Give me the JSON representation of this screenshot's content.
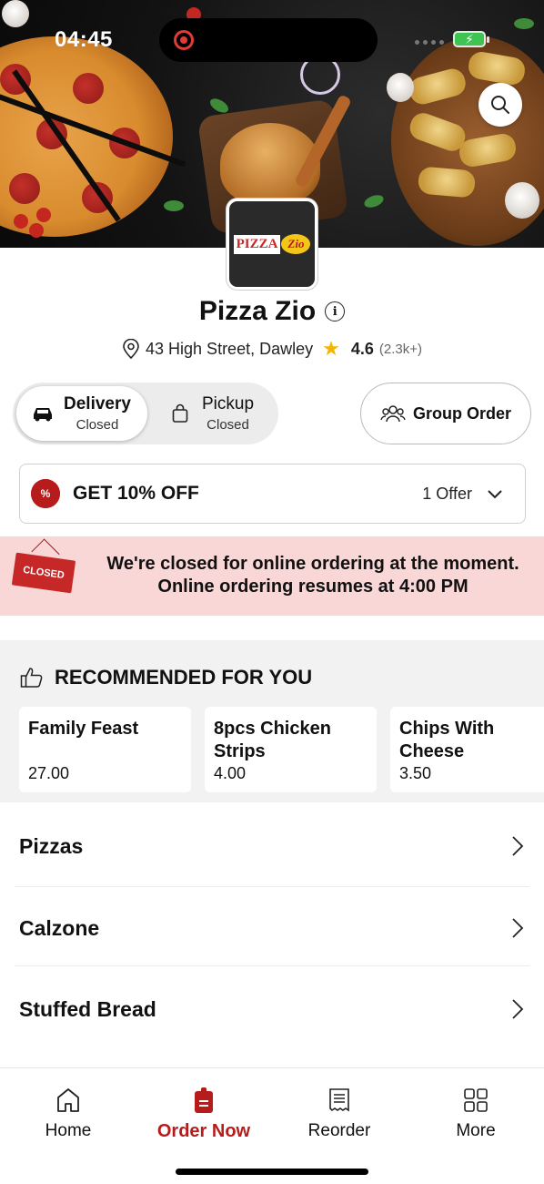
{
  "status_bar": {
    "time": "04:45"
  },
  "restaurant": {
    "name": "Pizza Zio",
    "address": "43 High Street, Dawley",
    "rating": "4.6",
    "rating_count": "(2.3k+)",
    "logo_text": "PIZZA",
    "logo_script": "Zio"
  },
  "order_mode": {
    "delivery": {
      "label": "Delivery",
      "status": "Closed",
      "selected": true
    },
    "pickup": {
      "label": "Pickup",
      "status": "Closed",
      "selected": false
    },
    "group_order_label": "Group Order"
  },
  "offer": {
    "title": "GET 10% OFF",
    "count": "1 Offer",
    "badge": "%"
  },
  "closed_banner": {
    "sign": "CLOSED",
    "line1": "We're closed for online ordering at the moment.",
    "line2": "Online ordering resumes at 4:00 PM"
  },
  "recommended": {
    "title": "RECOMMENDED FOR YOU",
    "items": [
      {
        "name": "Family Feast",
        "price": "27.00"
      },
      {
        "name": "8pcs Chicken Strips",
        "price": "4.00"
      },
      {
        "name": "Chips With Cheese",
        "price": "3.50"
      }
    ]
  },
  "categories": [
    "Pizzas",
    "Calzone",
    "Stuffed Bread"
  ],
  "bottom_nav": [
    {
      "label": "Home",
      "icon": "home-icon",
      "active": false
    },
    {
      "label": "Order Now",
      "icon": "order-icon",
      "active": true
    },
    {
      "label": "Reorder",
      "icon": "receipt-icon",
      "active": false
    },
    {
      "label": "More",
      "icon": "grid-icon",
      "active": false
    }
  ],
  "colors": {
    "accent": "#b71c1c",
    "banner_bg": "#f9d7d7",
    "section_bg": "#f2f2f2"
  }
}
